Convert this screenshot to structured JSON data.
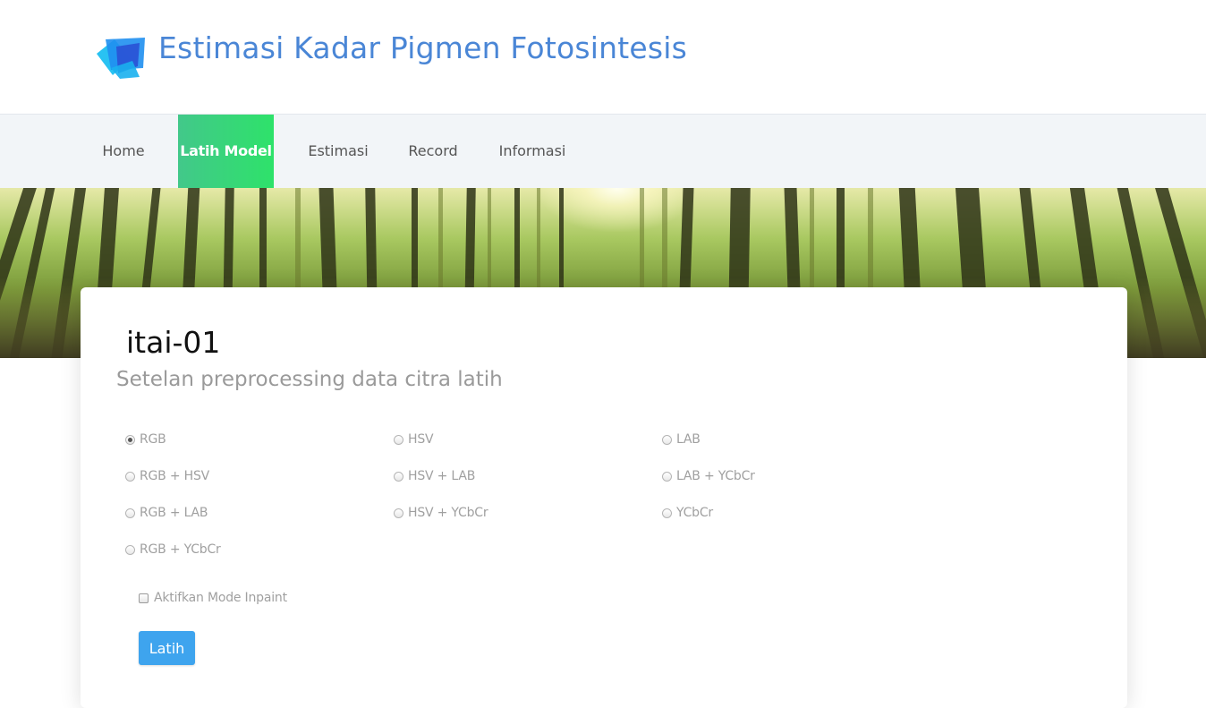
{
  "brand": {
    "title": "Estimasi Kadar Pigmen Fotosintesis",
    "logo_icon": "layered-squares-logo-icon",
    "title_color": "#4a86d6"
  },
  "nav": {
    "items": [
      {
        "label": "Home",
        "active": false
      },
      {
        "label": "Latih Model",
        "active": true
      },
      {
        "label": "Estimasi",
        "active": false
      },
      {
        "label": "Record",
        "active": false
      },
      {
        "label": "Informasi",
        "active": false
      }
    ],
    "active_color": "#2ee26a"
  },
  "hero": {
    "image": "bamboo-forest-banner"
  },
  "card": {
    "model_name": "itai-01",
    "section_title": "Setelan preprocessing data citra latih",
    "options": {
      "rgb": {
        "label": "RGB",
        "checked": true
      },
      "rgb_hsv": {
        "label": "RGB + HSV",
        "checked": false
      },
      "rgb_lab": {
        "label": "RGB + LAB",
        "checked": false
      },
      "rgb_ycbcr": {
        "label": "RGB + YCbCr",
        "checked": false
      },
      "hsv": {
        "label": "HSV",
        "checked": false
      },
      "hsv_lab": {
        "label": "HSV + LAB",
        "checked": false
      },
      "hsv_ycbcr": {
        "label": "HSV + YCbCr",
        "checked": false
      },
      "lab": {
        "label": "LAB",
        "checked": false
      },
      "lab_ycbcr": {
        "label": "LAB + YCbCr",
        "checked": false
      },
      "ycbcr": {
        "label": "YCbCr",
        "checked": false
      }
    },
    "inpaint": {
      "label": "Aktifkan Mode Inpaint",
      "checked": false
    },
    "train_button": {
      "label": "Latih",
      "color": "#3ea4ee"
    }
  }
}
